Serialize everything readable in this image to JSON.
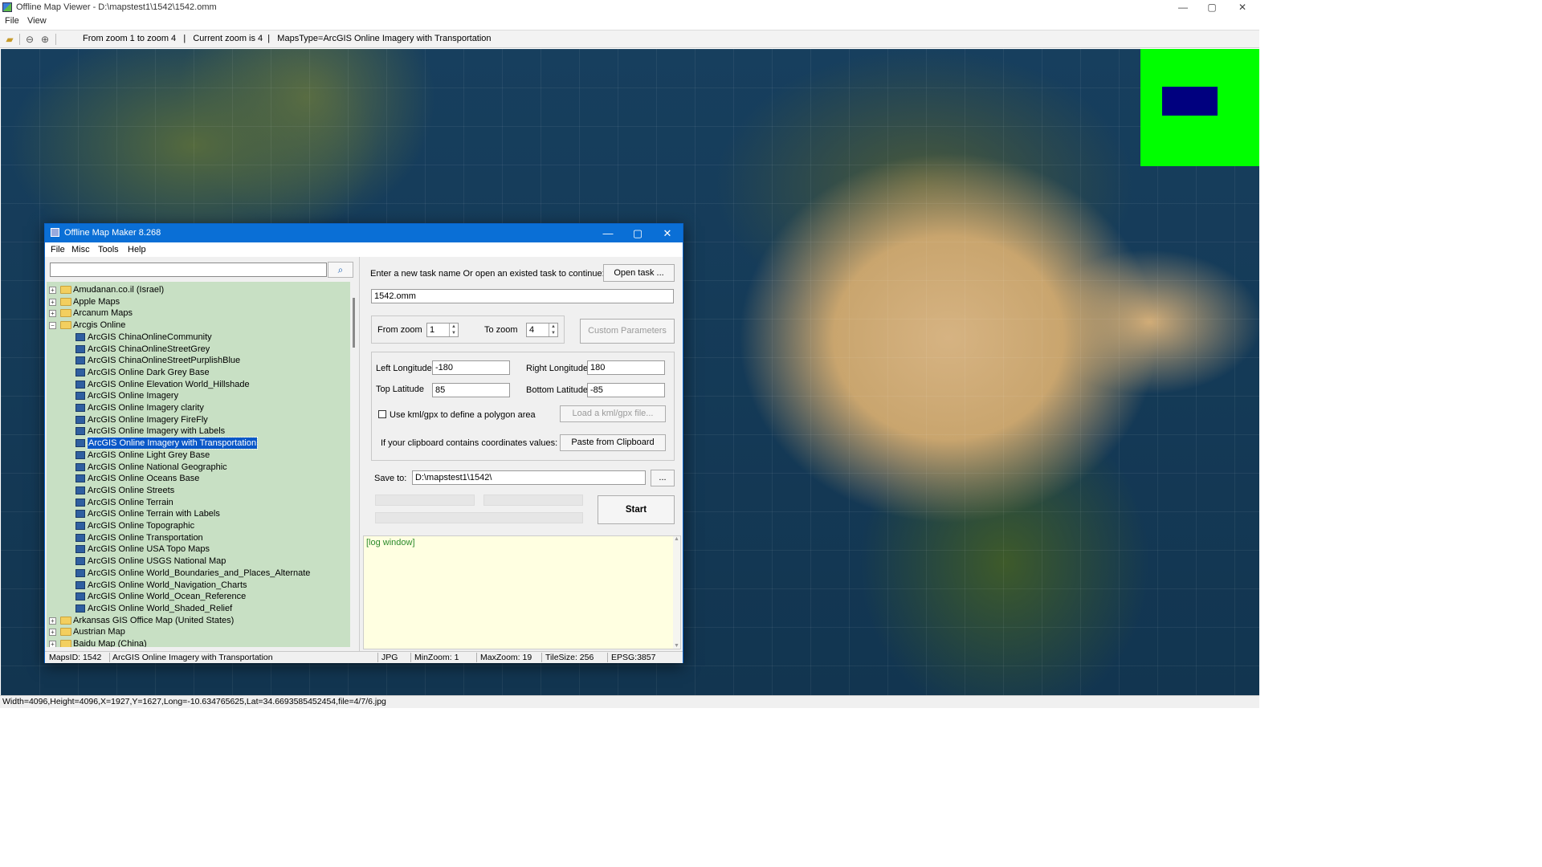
{
  "app": {
    "title": "Offline Map Viewer - D:\\mapstest1\\1542\\1542.omm",
    "controls": {
      "minimize": "—",
      "maximize": "▢",
      "close": "✕"
    }
  },
  "menu": {
    "file": "File",
    "view": "View"
  },
  "toolbar": {
    "info": "From zoom 1 to zoom 4   |   Current zoom is 4  |   MapsType=ArcGIS Online Imagery with Transportation",
    "icons": [
      "open-folder-icon",
      "zoom-out-icon",
      "zoom-in-icon"
    ]
  },
  "statusbar": {
    "text": "Width=4096,Height=4096,X=1927,Y=1627,Long=-10.634765625,Lat=34.6693585452454,file=4/7/6.jpg"
  },
  "overview": {
    "bg_color": "#00ff00",
    "viewport_color": "#00007f"
  },
  "dialog": {
    "title": "Offline Map Maker 8.268",
    "menu": [
      "File",
      "Misc",
      "Tools",
      "Help"
    ],
    "search": {
      "value": "",
      "placeholder": ""
    },
    "tree": [
      {
        "label": "Amudanan.co.il (Israel)",
        "type": "folder",
        "expanded": false
      },
      {
        "label": "Apple Maps",
        "type": "folder",
        "expanded": false
      },
      {
        "label": "Arcanum Maps",
        "type": "folder",
        "expanded": false
      },
      {
        "label": "Arcgis Online",
        "type": "folder",
        "expanded": true
      },
      {
        "label": "ArcGIS ChinaOnlineCommunity",
        "type": "map"
      },
      {
        "label": "ArcGIS ChinaOnlineStreetGrey",
        "type": "map"
      },
      {
        "label": "ArcGIS ChinaOnlineStreetPurplishBlue",
        "type": "map"
      },
      {
        "label": "ArcGIS Online Dark Grey Base",
        "type": "map"
      },
      {
        "label": "ArcGIS Online Elevation World_Hillshade",
        "type": "map"
      },
      {
        "label": "ArcGIS Online Imagery",
        "type": "map"
      },
      {
        "label": "ArcGIS Online Imagery clarity",
        "type": "map"
      },
      {
        "label": "ArcGIS Online Imagery FireFly",
        "type": "map"
      },
      {
        "label": "ArcGIS Online Imagery with Labels",
        "type": "map"
      },
      {
        "label": "ArcGIS Online Imagery with Transportation",
        "type": "map",
        "selected": true
      },
      {
        "label": "ArcGIS Online Light Grey Base",
        "type": "map"
      },
      {
        "label": "ArcGIS Online National Geographic",
        "type": "map"
      },
      {
        "label": "ArcGIS Online Oceans Base",
        "type": "map"
      },
      {
        "label": "ArcGIS Online Streets",
        "type": "map"
      },
      {
        "label": "ArcGIS Online Terrain",
        "type": "map"
      },
      {
        "label": "ArcGIS Online Terrain with Labels",
        "type": "map"
      },
      {
        "label": "ArcGIS Online Topographic",
        "type": "map"
      },
      {
        "label": "ArcGIS Online Transportation",
        "type": "map"
      },
      {
        "label": "ArcGIS Online USA Topo Maps",
        "type": "map"
      },
      {
        "label": "ArcGIS Online USGS National Map",
        "type": "map"
      },
      {
        "label": "ArcGIS Online World_Boundaries_and_Places_Alternate",
        "type": "map"
      },
      {
        "label": "ArcGIS Online World_Navigation_Charts",
        "type": "map"
      },
      {
        "label": "ArcGIS Online World_Ocean_Reference",
        "type": "map"
      },
      {
        "label": "ArcGIS Online World_Shaded_Relief",
        "type": "map"
      },
      {
        "label": "Arkansas GIS Office Map (United States)",
        "type": "folder",
        "expanded": false
      },
      {
        "label": "Austrian Map",
        "type": "folder",
        "expanded": false
      },
      {
        "label": "Baidu Map (China)",
        "type": "folder",
        "expanded": false
      }
    ],
    "task": {
      "prompt": "Enter a new task name Or open an existed task to continue:",
      "open_button": "Open task ...",
      "name": "1542.omm"
    },
    "zoom": {
      "from_label": "From zoom",
      "from_value": "1",
      "to_label": "To zoom",
      "to_value": "4",
      "custom_button": "Custom Parameters"
    },
    "coords": {
      "left_lon_label": "Left Longitude",
      "left_lon": "-180",
      "right_lon_label": "Right Longitude",
      "right_lon": "180",
      "top_lat_label": "Top Latitude",
      "top_lat": "85",
      "bottom_lat_label": "Bottom Latitude",
      "bottom_lat": "-85",
      "kml_label": "Use kml/gpx to define a polygon area",
      "kml_checked": false,
      "kml_button": "Load a kml/gpx file...",
      "clipboard_label": "If your clipboard contains coordinates values:",
      "clipboard_button": "Paste from Clipboard"
    },
    "save": {
      "label": "Save to:",
      "path": "D:\\mapstest1\\1542\\",
      "browse": "..."
    },
    "start_button": "Start",
    "log": "[log window]",
    "status": {
      "maps_id": "MapsID: 1542",
      "maps_name": "ArcGIS Online Imagery with Transportation",
      "format": "JPG",
      "min_zoom": "MinZoom: 1",
      "max_zoom": "MaxZoom: 19",
      "tile_size": "TileSize: 256",
      "epsg": "EPSG:3857"
    }
  }
}
